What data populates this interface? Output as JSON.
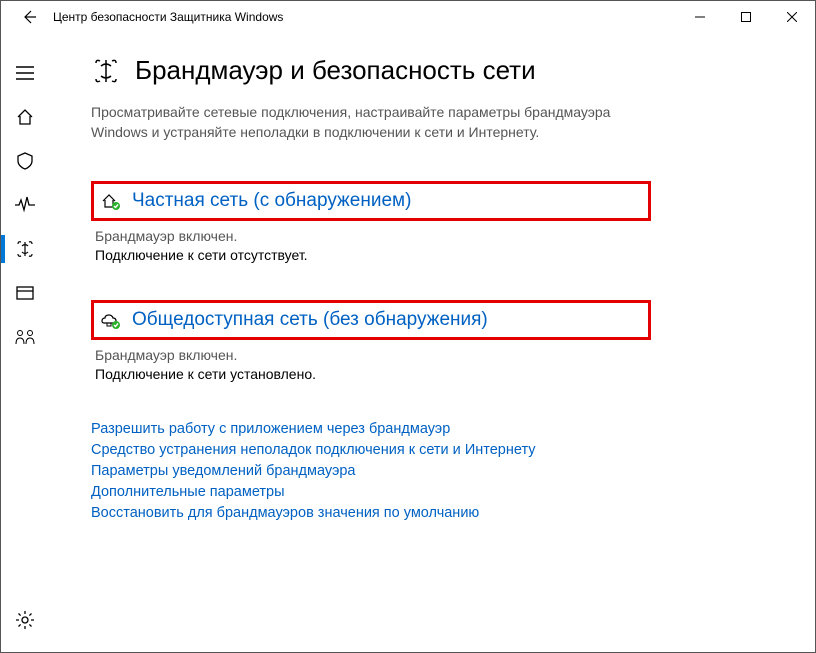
{
  "window": {
    "title": "Центр безопасности Защитника Windows"
  },
  "page": {
    "title": "Брандмауэр и безопасность сети",
    "description": "Просматривайте сетевые подключения, настраивайте параметры брандмауэра Windows и устраняйте неполадки в подключении к сети и Интернету."
  },
  "networks": [
    {
      "title": "Частная сеть (с обнаружением)",
      "status": "Брандмауэр включен.",
      "connection": "Подключение к сети отсутствует."
    },
    {
      "title": "Общедоступная сеть (без обнаружения)",
      "status": "Брандмауэр включен.",
      "connection": "Подключение к сети установлено."
    }
  ],
  "links": [
    "Разрешить работу с приложением через брандмауэр",
    "Средство устранения неполадок подключения к сети и Интернету",
    "Параметры уведомлений брандмауэра",
    "Дополнительные параметры",
    "Восстановить для брандмауэров значения по умолчанию"
  ]
}
